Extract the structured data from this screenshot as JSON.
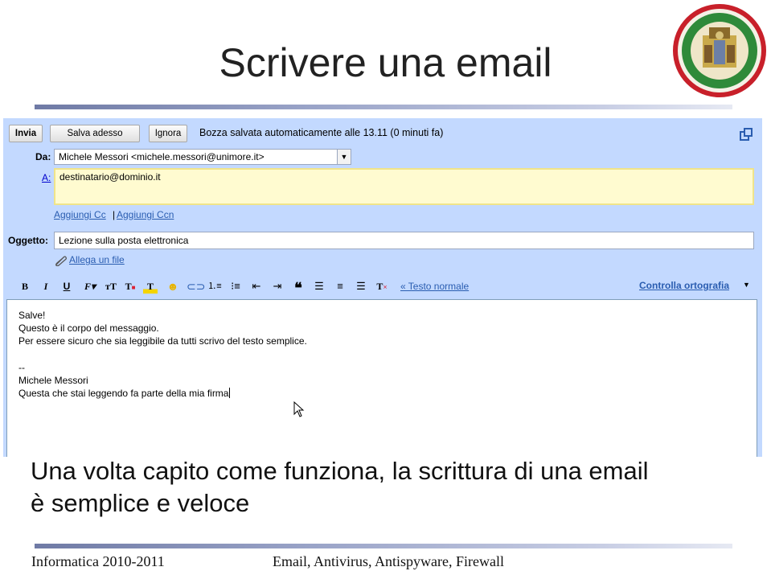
{
  "slide": {
    "title": "Scrivere una email",
    "caption_line1": "Una volta capito come funziona, la scrittura di una email",
    "caption_line2": "è semplice e veloce",
    "footer_left": "Informatica 2010-2011",
    "footer_center": "Email, Antivirus, Antispyware, Firewall"
  },
  "gmail": {
    "buttons": {
      "send": "Invia",
      "save": "Salva adesso",
      "discard": "Ignora"
    },
    "saved_status": "Bozza salvata automaticamente alle 13.11 (0 minuti fa)",
    "from_label": "Da:",
    "from_value": "Michele Messori <michele.messori@unimore.it>",
    "to_label": "A:",
    "to_value": "destinatario@dominio.it",
    "add_cc": "Aggiungi Cc",
    "separator": "|",
    "add_bcc": "Aggiungi Ccn",
    "subject_label": "Oggetto:",
    "subject_value": "Lezione sulla posta elettronica",
    "attach": "Allega un file",
    "plain_text": "« Testo normale",
    "spellcheck": "Controlla ortografia",
    "body_lines": [
      "Salve!",
      "Questo è il corpo del messaggio.",
      "Per essere sicuro che sia leggibile da tutti scrivo del testo semplice.",
      "--",
      "Michele Messori",
      "Questa che stai leggendo fa parte della mia firma"
    ]
  },
  "toolbar_icons": [
    "bold-icon",
    "italic-icon",
    "underline-icon",
    "font-icon",
    "font-size-icon",
    "text-color-icon",
    "highlight-icon",
    "emoticon-icon",
    "link-icon",
    "numbered-list-icon",
    "bulleted-list-icon",
    "outdent-icon",
    "indent-icon",
    "quote-icon",
    "align-left-icon",
    "align-center-icon",
    "align-right-icon",
    "remove-formatting-icon"
  ],
  "colors": {
    "gmail_bg": "#c3d9ff",
    "link": "#0000cc",
    "to_field_highlight": "#fffbd0"
  }
}
